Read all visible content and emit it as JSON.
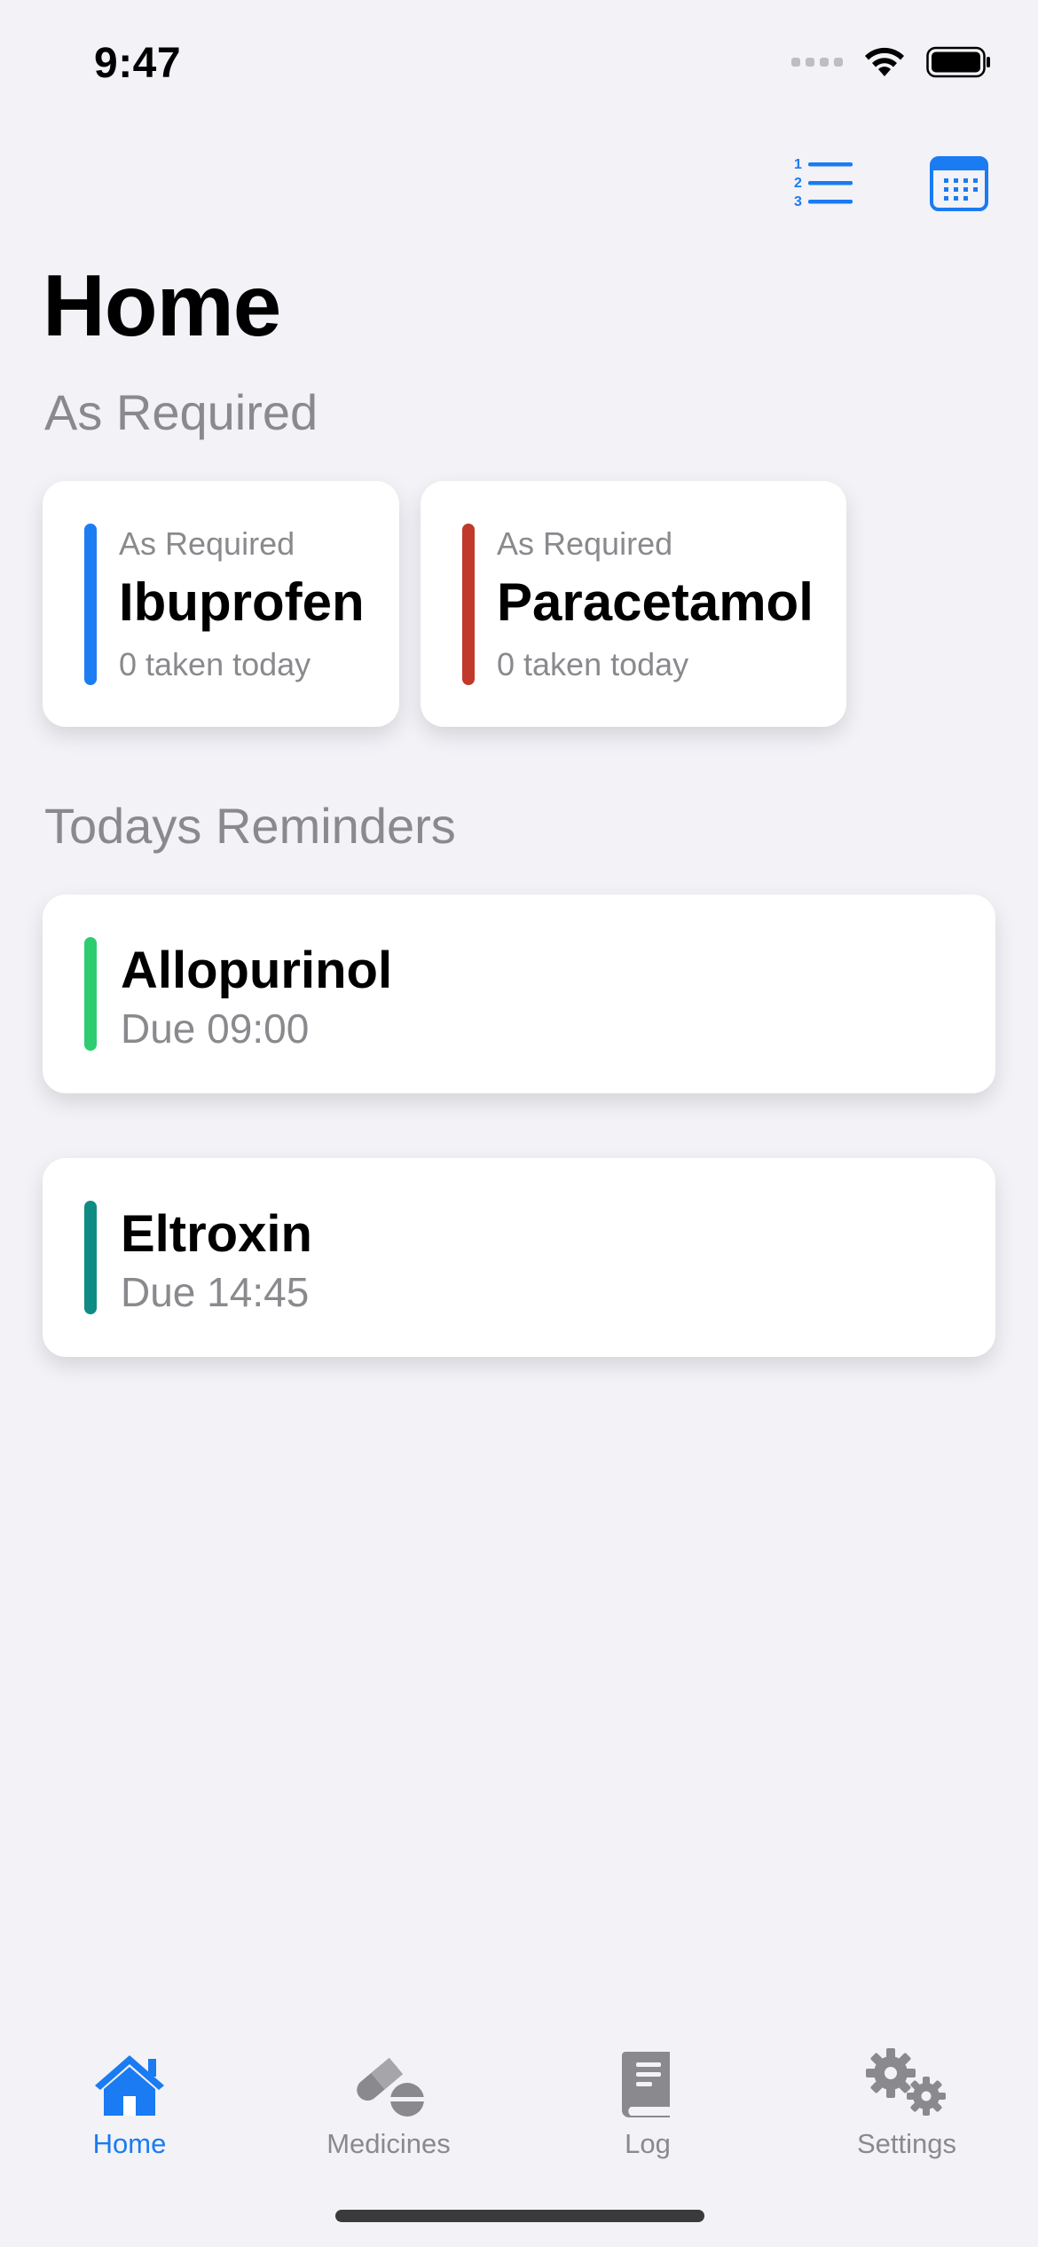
{
  "status_bar": {
    "time": "9:47"
  },
  "colors": {
    "accent": "#1A7BF2",
    "ibuprofen": "#1E7CF2",
    "paracetamol": "#C0392B",
    "allopurinol": "#2ECC71",
    "eltroxin": "#0E8C84"
  },
  "toolbar": {
    "list_icon": "numbered-list-icon",
    "calendar_icon": "calendar-icon"
  },
  "page": {
    "title": "Home",
    "as_required_title": "As Required",
    "reminders_title": "Todays Reminders"
  },
  "as_required": [
    {
      "caption": "As Required",
      "name": "Ibuprofen",
      "taken": "0 taken today"
    },
    {
      "caption": "As Required",
      "name": "Paracetamol",
      "taken": "0 taken today"
    }
  ],
  "reminders": [
    {
      "name": "Allopurinol",
      "due": "Due 09:00"
    },
    {
      "name": "Eltroxin",
      "due": "Due 14:45"
    }
  ],
  "tabs": [
    {
      "label": "Home",
      "icon": "house-icon",
      "active": true
    },
    {
      "label": "Medicines",
      "icon": "pills-icon",
      "active": false
    },
    {
      "label": "Log",
      "icon": "book-icon",
      "active": false
    },
    {
      "label": "Settings",
      "icon": "gears-icon",
      "active": false
    }
  ]
}
